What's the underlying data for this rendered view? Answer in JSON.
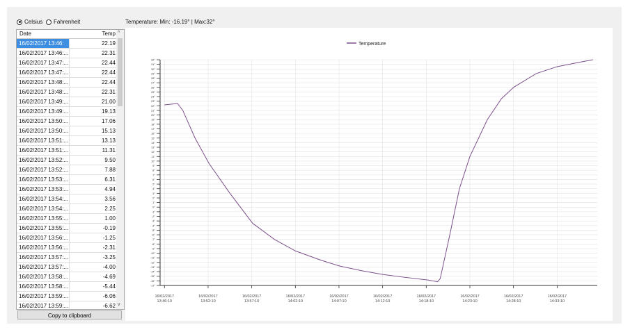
{
  "units": {
    "celsius": "Celsius",
    "fahrenheit": "Fahrenheit",
    "selected": "celsius"
  },
  "status": "Temperature: Min: -16.19° | Max:32°",
  "table": {
    "headers": [
      "Date",
      "Temp"
    ],
    "rows": [
      [
        "16/02/2017 13:46:",
        "22.19"
      ],
      [
        "16/02/2017 13:46:...",
        "22.31"
      ],
      [
        "16/02/2017 13:47:...",
        "22.44"
      ],
      [
        "16/02/2017 13:47:...",
        "22.44"
      ],
      [
        "16/02/2017 13:48:...",
        "22.44"
      ],
      [
        "16/02/2017 13:48:...",
        "22.31"
      ],
      [
        "16/02/2017 13:49:...",
        "21.00"
      ],
      [
        "16/02/2017 13:49:...",
        "19.13"
      ],
      [
        "16/02/2017 13:50:...",
        "17.06"
      ],
      [
        "16/02/2017 13:50:...",
        "15.13"
      ],
      [
        "16/02/2017 13:51:...",
        "13.13"
      ],
      [
        "16/02/2017 13:51:...",
        "11.31"
      ],
      [
        "16/02/2017 13:52:...",
        "9.50"
      ],
      [
        "16/02/2017 13:52:...",
        "7.88"
      ],
      [
        "16/02/2017 13:53:...",
        "6.31"
      ],
      [
        "16/02/2017 13:53:...",
        "4.94"
      ],
      [
        "16/02/2017 13:54:...",
        "3.56"
      ],
      [
        "16/02/2017 13:54:...",
        "2.25"
      ],
      [
        "16/02/2017 13:55:...",
        "1.00"
      ],
      [
        "16/02/2017 13:55:...",
        "-0.19"
      ],
      [
        "16/02/2017 13:56:...",
        "-1.25"
      ],
      [
        "16/02/2017 13:56:...",
        "-2.31"
      ],
      [
        "16/02/2017 13:57:...",
        "-3.25"
      ],
      [
        "16/02/2017 13:57:...",
        "-4.00"
      ],
      [
        "16/02/2017 13:58:...",
        "-4.69"
      ],
      [
        "16/02/2017 13:58:...",
        "-5.44"
      ],
      [
        "16/02/2017 13:59:...",
        "-6.06"
      ],
      [
        "16/02/2017 13:59:...",
        "-6.62"
      ]
    ]
  },
  "copy_button": "Copy to clipboard",
  "chart_data": {
    "type": "line",
    "legend": [
      "Temperature"
    ],
    "legend_position": "top-center",
    "series": [
      {
        "name": "Temperature",
        "color": "#7b4f8a",
        "x": [
          0,
          1.5,
          2.1,
          3.5,
          5.1,
          7.5,
          10.1,
          12.6,
          15.0,
          17.9,
          20.1,
          22.6,
          25.0,
          27.4,
          30.1,
          31.3,
          31.6,
          32.7,
          33.8,
          35.0,
          37.0,
          38.6,
          40.0,
          42.6,
          45.0,
          47.4,
          49.1
        ],
        "y": [
          22.2,
          22.5,
          21,
          15,
          9.5,
          3,
          -3.5,
          -7,
          -9.5,
          -11.5,
          -12.8,
          -13.8,
          -14.6,
          -15.2,
          -15.8,
          -16.19,
          -15.5,
          -6,
          4,
          11,
          19,
          23.5,
          26,
          29,
          30.5,
          31.4,
          32
        ]
      }
    ],
    "xlim": [
      -0.5,
      49.6
    ],
    "ylim": [
      -17,
      32
    ],
    "x_ticks": [
      0,
      5,
      10,
      15,
      20,
      25,
      30,
      35,
      40,
      45
    ],
    "x_tick_labels": [
      [
        "16/02/2017",
        "13:46:10"
      ],
      [
        "16/02/2017",
        "13:52:10"
      ],
      [
        "16/02/2017",
        "13:57:10"
      ],
      [
        "16/02/2017",
        "14:02:10"
      ],
      [
        "16/02/2017",
        "14:07:10"
      ],
      [
        "16/02/2017",
        "14:12:10"
      ],
      [
        "16/02/2017",
        "14:18:10"
      ],
      [
        "16/02/2017",
        "14:23:10"
      ],
      [
        "16/02/2017",
        "14:28:10"
      ],
      [
        "16/02/2017",
        "14:33:10"
      ]
    ],
    "y_tick_step": 1,
    "grid": true
  }
}
